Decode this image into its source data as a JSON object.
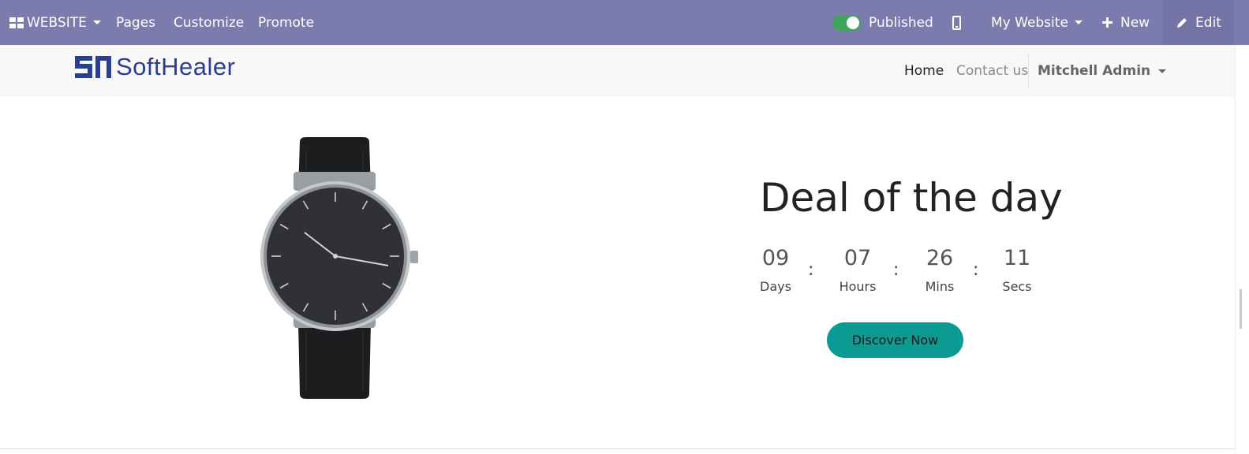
{
  "adminbar": {
    "app_label": "WEBSITE",
    "menu": [
      "Pages",
      "Customize",
      "Promote"
    ],
    "published_label": "Published",
    "published": true,
    "website_label": "My Website",
    "new_label": "New",
    "edit_label": "Edit",
    "bg_color": "#7c7bad",
    "toggle_color": "#3fa55b"
  },
  "header": {
    "logo_text": "SoftHealer",
    "nav": {
      "home": "Home",
      "contact": "Contact us",
      "user": "Mitchell Admin"
    }
  },
  "deal": {
    "title": "Deal of the day",
    "countdown": [
      {
        "value": "09",
        "label": "Days"
      },
      {
        "value": "07",
        "label": "Hours"
      },
      {
        "value": "26",
        "label": "Mins"
      },
      {
        "value": "11",
        "label": "Secs"
      }
    ],
    "separator": ":",
    "cta_label": "Discover Now",
    "cta_color": "#0b9b93"
  }
}
